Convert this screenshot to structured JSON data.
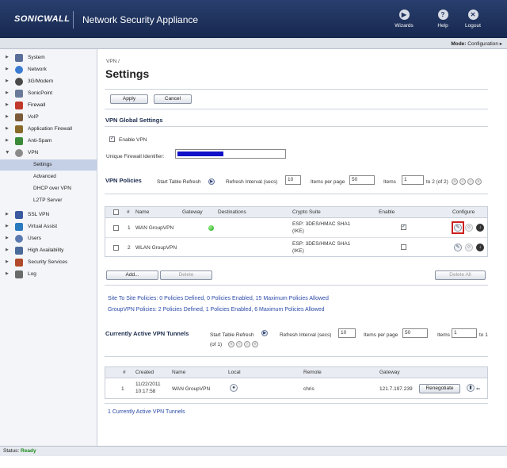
{
  "header": {
    "logo": "SONICWALL",
    "product": "Network Security Appliance",
    "buttons": [
      {
        "label": "Wizards",
        "icon": "wizard-icon"
      },
      {
        "label": "Help",
        "icon": "help-icon"
      },
      {
        "label": "Logout",
        "icon": "logout-icon"
      }
    ],
    "mode_label": "Mode:",
    "mode_value": "Configuration ▸"
  },
  "sidebar": {
    "items": [
      {
        "label": "System",
        "icon": "system-icon",
        "color": "#5a6e9a"
      },
      {
        "label": "Network",
        "icon": "network-icon",
        "color": "#3b7bd0"
      },
      {
        "label": "3G/Modem",
        "icon": "modem-icon",
        "color": "#4a4a4a"
      },
      {
        "label": "SonicPoint",
        "icon": "sonicpoint-icon",
        "color": "#6a7a9a"
      },
      {
        "label": "Firewall",
        "icon": "firewall-icon",
        "color": "#c0392b"
      },
      {
        "label": "VoIP",
        "icon": "voip-icon",
        "color": "#7a5a3a"
      },
      {
        "label": "Application Firewall",
        "icon": "application-firewall-icon",
        "color": "#8a6a2a"
      },
      {
        "label": "Anti-Spam",
        "icon": "anti-spam-icon",
        "color": "#3a8a3a"
      },
      {
        "label": "VPN",
        "icon": "vpn-icon",
        "color": "#8a8a8a"
      }
    ],
    "vpn_sub": [
      "Settings",
      "Advanced",
      "DHCP over VPN",
      "L2TP Server"
    ],
    "items_after": [
      {
        "label": "SSL VPN",
        "icon": "ssl-vpn-icon",
        "color": "#3a5aa0"
      },
      {
        "label": "Virtual Assist",
        "icon": "virtual-assist-icon",
        "color": "#2a7ac0"
      },
      {
        "label": "Users",
        "icon": "users-icon",
        "color": "#5a7ab0"
      },
      {
        "label": "High Availability",
        "icon": "high-availability-icon",
        "color": "#4a6a9a"
      },
      {
        "label": "Security Services",
        "icon": "security-services-icon",
        "color": "#b04a2a"
      },
      {
        "label": "Log",
        "icon": "log-icon",
        "color": "#6a6a6a"
      }
    ]
  },
  "main": {
    "breadcrumb": "VPN /",
    "title": "Settings",
    "apply": "Apply",
    "cancel": "Cancel",
    "global_title": "VPN Global Settings",
    "enable_vpn": "Enable VPN",
    "enable_vpn_checked": true,
    "firewall_id_label": "Unique Firewall Identifier:",
    "policies": {
      "title": "VPN Policies",
      "start_refresh": "Start Table Refresh",
      "refresh_label": "Refresh Interval (secs)",
      "refresh_value": "10",
      "items_per_page_label": "Items per page",
      "items_per_page_value": "50",
      "items_label": "Items",
      "items_value": "1",
      "items_range": "to 2 (of 2)",
      "columns": [
        "#",
        "Name",
        "Gateway",
        "Destinations",
        "Crypto Suite",
        "Enable",
        "Configure"
      ],
      "rows": [
        {
          "num": "1",
          "name": "WAN GroupVPN",
          "gateway_status": "green",
          "crypto": [
            "ESP: 3DES/HMAC SHA1",
            "(IKE)"
          ],
          "enabled": true
        },
        {
          "num": "2",
          "name": "WLAN GroupVPN",
          "gateway_status": "",
          "crypto": [
            "ESP: 3DES/HMAC SHA1",
            "(IKE)"
          ],
          "enabled": false
        }
      ],
      "add": "Add...",
      "delete": "Delete",
      "delete_all": "Delete All",
      "summary1": "Site To Site Policies: 0 Policies Defined, 0 Policies Enabled, 15 Maximum Policies Allowed",
      "summary2": "GroupVPN Policies: 2 Policies Defined, 1 Policies Enabled, 6 Maximum Policies Allowed"
    },
    "tunnels": {
      "title": "Currently Active VPN Tunnels",
      "start_refresh": "Start Table Refresh",
      "of": "(of 1)",
      "refresh_label": "Refresh Interval (secs)",
      "refresh_value": "10",
      "items_per_page_label": "Items per page",
      "items_per_page_value": "50",
      "items_label": "Items",
      "items_value": "1",
      "items_to": "to 1",
      "columns": [
        "#",
        "Created",
        "Name",
        "Local",
        "Remote",
        "Gateway"
      ],
      "rows": [
        {
          "num": "1",
          "created": [
            "11/22/2011",
            "10:17:58"
          ],
          "name": "WAN GroupVPN",
          "remote": "chris",
          "gateway": "121.7.197.239",
          "renegotiate": "Renegotiate"
        }
      ],
      "summary": "1 Currently Active VPN Tunnels"
    }
  },
  "status": {
    "label": "Status:",
    "value": "Ready"
  }
}
